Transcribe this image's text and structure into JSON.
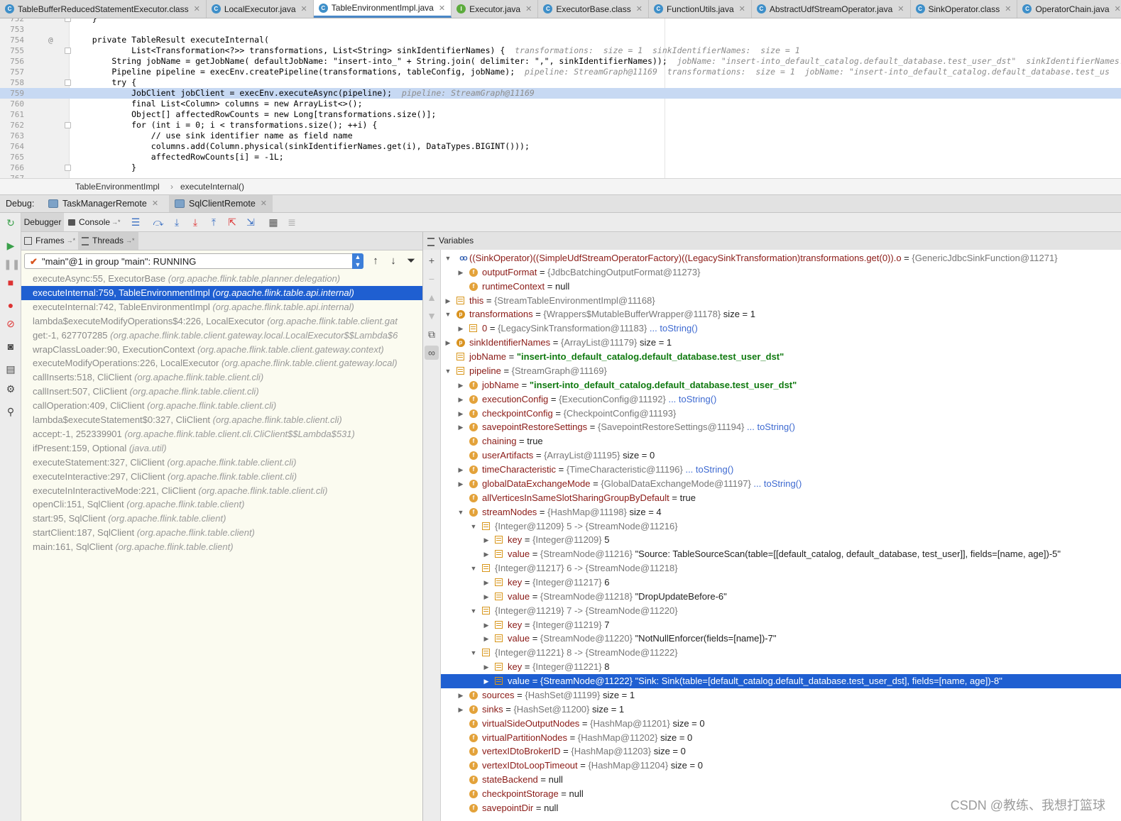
{
  "tabs": [
    {
      "label": "TableBufferReducedStatementExecutor.class",
      "icon": "C",
      "active": false
    },
    {
      "label": "LocalExecutor.java",
      "icon": "C",
      "active": false
    },
    {
      "label": "TableEnvironmentImpl.java",
      "icon": "C",
      "active": true
    },
    {
      "label": "Executor.java",
      "icon": "I",
      "active": false
    },
    {
      "label": "ExecutorBase.class",
      "icon": "C",
      "active": false
    },
    {
      "label": "FunctionUtils.java",
      "icon": "C",
      "active": false
    },
    {
      "label": "AbstractUdfStreamOperator.java",
      "icon": "C",
      "active": false
    },
    {
      "label": "SinkOperator.class",
      "icon": "C",
      "active": false
    },
    {
      "label": "OperatorChain.java",
      "icon": "C",
      "active": false
    },
    {
      "label": "S",
      "icon": "C",
      "active": false
    }
  ],
  "editor": {
    "lines": [
      {
        "num": "752",
        "code": "    }",
        "hint": "",
        "mark": ""
      },
      {
        "num": "753",
        "code": "",
        "hint": "",
        "mark": ""
      },
      {
        "num": "754",
        "code": "    private TableResult executeInternal(",
        "hint": "",
        "mark": "@"
      },
      {
        "num": "755",
        "code": "            List<Transformation<?>> transformations, List<String> sinkIdentifierNames) {",
        "hint": "  transformations:  size = 1  sinkIdentifierNames:  size = 1",
        "mark": ""
      },
      {
        "num": "756",
        "code": "        String jobName = getJobName( defaultJobName: \"insert-into_\" + String.join( delimiter: \",\", sinkIdentifierNames));",
        "hint": "  jobName: \"insert-into_default_catalog.default_database.test_user_dst\"  sinkIdentifierNames:",
        "mark": ""
      },
      {
        "num": "757",
        "code": "        Pipeline pipeline = execEnv.createPipeline(transformations, tableConfig, jobName);",
        "hint": "  pipeline: StreamGraph@11169  transformations:  size = 1  jobName: \"insert-into_default_catalog.default_database.test_us",
        "mark": ""
      },
      {
        "num": "758",
        "code": "        try {",
        "hint": "",
        "mark": ""
      },
      {
        "num": "759",
        "code": "            JobClient jobClient = execEnv.executeAsync(pipeline);",
        "hint": "  pipeline: StreamGraph@11169",
        "mark": ""
      },
      {
        "num": "760",
        "code": "            final List<Column> columns = new ArrayList<>();",
        "hint": "",
        "mark": ""
      },
      {
        "num": "761",
        "code": "            Object[] affectedRowCounts = new Long[transformations.size()];",
        "hint": "",
        "mark": ""
      },
      {
        "num": "762",
        "code": "            for (int i = 0; i < transformations.size(); ++i) {",
        "hint": "",
        "mark": ""
      },
      {
        "num": "763",
        "code": "                // use sink identifier name as field name",
        "hint": "",
        "mark": ""
      },
      {
        "num": "764",
        "code": "                columns.add(Column.physical(sinkIdentifierNames.get(i), DataTypes.BIGINT()));",
        "hint": "",
        "mark": ""
      },
      {
        "num": "765",
        "code": "                affectedRowCounts[i] = -1L;",
        "hint": "",
        "mark": ""
      },
      {
        "num": "766",
        "code": "            }",
        "hint": "",
        "mark": ""
      },
      {
        "num": "767",
        "code": "",
        "hint": "",
        "mark": ""
      }
    ]
  },
  "breadcrumb": {
    "class_name": "TableEnvironmentImpl",
    "separator": "›",
    "method": "executeInternal()"
  },
  "debug": {
    "label": "Debug:",
    "sessions": [
      {
        "label": "TaskManagerRemote",
        "active": false
      },
      {
        "label": "SqlClientRemote",
        "active": true
      }
    ],
    "tabs": {
      "debugger": "Debugger",
      "console": "Console",
      "console_suffix": "→*"
    }
  },
  "frames": {
    "tab_frames": "Frames",
    "tab_threads": "Threads",
    "tab_suffix": "→*",
    "thread": "\"main\"@1 in group \"main\": RUNNING",
    "items": [
      {
        "text": "executeAsync:55, ExecutorBase ",
        "pkg": "(org.apache.flink.table.planner.delegation)"
      },
      {
        "text": "executeInternal:759, TableEnvironmentImpl ",
        "pkg": "(org.apache.flink.table.api.internal)"
      },
      {
        "text": "executeInternal:742, TableEnvironmentImpl ",
        "pkg": "(org.apache.flink.table.api.internal)"
      },
      {
        "text": "lambda$executeModifyOperations$4:226, LocalExecutor ",
        "pkg": "(org.apache.flink.table.client.gat"
      },
      {
        "text": "get:-1, 627707285 ",
        "pkg": "(org.apache.flink.table.client.gateway.local.LocalExecutor$$Lambda$6"
      },
      {
        "text": "wrapClassLoader:90, ExecutionContext ",
        "pkg": "(org.apache.flink.table.client.gateway.context)"
      },
      {
        "text": "executeModifyOperations:226, LocalExecutor ",
        "pkg": "(org.apache.flink.table.client.gateway.local)"
      },
      {
        "text": "callInserts:518, CliClient ",
        "pkg": "(org.apache.flink.table.client.cli)"
      },
      {
        "text": "callInsert:507, CliClient ",
        "pkg": "(org.apache.flink.table.client.cli)"
      },
      {
        "text": "callOperation:409, CliClient ",
        "pkg": "(org.apache.flink.table.client.cli)"
      },
      {
        "text": "lambda$executeStatement$0:327, CliClient ",
        "pkg": "(org.apache.flink.table.client.cli)"
      },
      {
        "text": "accept:-1, 252339901 ",
        "pkg": "(org.apache.flink.table.client.cli.CliClient$$Lambda$531)"
      },
      {
        "text": "ifPresent:159, Optional ",
        "pkg": "(java.util)"
      },
      {
        "text": "executeStatement:327, CliClient ",
        "pkg": "(org.apache.flink.table.client.cli)"
      },
      {
        "text": "executeInteractive:297, CliClient ",
        "pkg": "(org.apache.flink.table.client.cli)"
      },
      {
        "text": "executeInInteractiveMode:221, CliClient ",
        "pkg": "(org.apache.flink.table.client.cli)"
      },
      {
        "text": "openCli:151, SqlClient ",
        "pkg": "(org.apache.flink.table.client)"
      },
      {
        "text": "start:95, SqlClient ",
        "pkg": "(org.apache.flink.table.client)"
      },
      {
        "text": "startClient:187, SqlClient ",
        "pkg": "(org.apache.flink.table.client)"
      },
      {
        "text": "main:161, SqlClient ",
        "pkg": "(org.apache.flink.table.client)"
      }
    ],
    "selected_index": 1
  },
  "variables": {
    "title": "Variables",
    "rows": [
      {
        "depth": 0,
        "tw": "▼",
        "icon": "oo",
        "name": "((SinkOperator)((SimpleUdfStreamOperatorFactory)((LegacySinkTransformation)transformations.get(0)).o",
        "eq": " = ",
        "value": "{GenericJdbcSinkFunction@11271}",
        "str": "",
        "extra": "",
        "link": ""
      },
      {
        "depth": 1,
        "tw": "▶",
        "icon": "f",
        "name": "outputFormat",
        "eq": " = ",
        "value": "{JdbcBatchingOutputFormat@11273}",
        "str": "",
        "extra": "",
        "link": ""
      },
      {
        "depth": 1,
        "tw": "",
        "icon": "f",
        "name": "runtimeContext",
        "eq": " = ",
        "value": "",
        "str": "",
        "extra": "null",
        "link": ""
      },
      {
        "depth": 0,
        "tw": "▶",
        "icon": "arr",
        "name": "this",
        "eq": " = ",
        "value": "{StreamTableEnvironmentImpl@11168}",
        "str": "",
        "extra": "",
        "link": ""
      },
      {
        "depth": 0,
        "tw": "▼",
        "icon": "p",
        "name": "transformations",
        "eq": " = ",
        "value": "{Wrappers$MutableBufferWrapper@11178}",
        "str": "",
        "extra": "  size = 1",
        "link": ""
      },
      {
        "depth": 1,
        "tw": "▶",
        "icon": "arr",
        "name": "0",
        "eq": " = ",
        "value": "{LegacySinkTransformation@11183}",
        "str": "",
        "extra": "",
        "link": " ... toString()"
      },
      {
        "depth": 0,
        "tw": "▶",
        "icon": "p",
        "name": "sinkIdentifierNames",
        "eq": " = ",
        "value": "{ArrayList@11179}",
        "str": "",
        "extra": "  size = 1",
        "link": ""
      },
      {
        "depth": 0,
        "tw": "",
        "icon": "arr",
        "name": "jobName",
        "eq": " = ",
        "value": "",
        "str": "\"insert-into_default_catalog.default_database.test_user_dst\"",
        "extra": "",
        "link": ""
      },
      {
        "depth": 0,
        "tw": "▼",
        "icon": "arr",
        "name": "pipeline",
        "eq": " = ",
        "value": "{StreamGraph@11169}",
        "str": "",
        "extra": "",
        "link": ""
      },
      {
        "depth": 1,
        "tw": "▶",
        "icon": "f",
        "name": "jobName",
        "eq": " = ",
        "value": "",
        "str": "\"insert-into_default_catalog.default_database.test_user_dst\"",
        "extra": "",
        "link": ""
      },
      {
        "depth": 1,
        "tw": "▶",
        "icon": "f",
        "name": "executionConfig",
        "eq": " = ",
        "value": "{ExecutionConfig@11192}",
        "str": "",
        "extra": "",
        "link": " ... toString()"
      },
      {
        "depth": 1,
        "tw": "▶",
        "icon": "f",
        "name": "checkpointConfig",
        "eq": " = ",
        "value": "{CheckpointConfig@11193}",
        "str": "",
        "extra": "",
        "link": ""
      },
      {
        "depth": 1,
        "tw": "▶",
        "icon": "f",
        "name": "savepointRestoreSettings",
        "eq": " = ",
        "value": "{SavepointRestoreSettings@11194}",
        "str": "",
        "extra": "",
        "link": " ... toString()"
      },
      {
        "depth": 1,
        "tw": "",
        "icon": "f",
        "name": "chaining",
        "eq": " = ",
        "value": "",
        "str": "",
        "extra": "true",
        "link": ""
      },
      {
        "depth": 1,
        "tw": "",
        "icon": "f",
        "name": "userArtifacts",
        "eq": " = ",
        "value": "{ArrayList@11195}",
        "str": "",
        "extra": "  size = 0",
        "link": ""
      },
      {
        "depth": 1,
        "tw": "▶",
        "icon": "f",
        "name": "timeCharacteristic",
        "eq": " = ",
        "value": "{TimeCharacteristic@11196}",
        "str": "",
        "extra": "",
        "link": " ... toString()"
      },
      {
        "depth": 1,
        "tw": "▶",
        "icon": "f",
        "name": "globalDataExchangeMode",
        "eq": " = ",
        "value": "{GlobalDataExchangeMode@11197}",
        "str": "",
        "extra": "",
        "link": " ... toString()"
      },
      {
        "depth": 1,
        "tw": "",
        "icon": "f",
        "name": "allVerticesInSameSlotSharingGroupByDefault",
        "eq": " = ",
        "value": "",
        "str": "",
        "extra": "true",
        "link": ""
      },
      {
        "depth": 1,
        "tw": "▼",
        "icon": "f",
        "name": "streamNodes",
        "eq": " = ",
        "value": "{HashMap@11198}",
        "str": "",
        "extra": "  size = 4",
        "link": ""
      },
      {
        "depth": 2,
        "tw": "▼",
        "icon": "arr",
        "name": "",
        "eq": "",
        "value": "{Integer@11209} 5 -> {StreamNode@11216}",
        "str": "",
        "extra": "",
        "link": ""
      },
      {
        "depth": 3,
        "tw": "▶",
        "icon": "arr",
        "name": "key",
        "eq": " = ",
        "value": "{Integer@11209} ",
        "str": "",
        "extra": "5",
        "link": ""
      },
      {
        "depth": 3,
        "tw": "▶",
        "icon": "arr",
        "name": "value",
        "eq": " = ",
        "value": "{StreamNode@11216} ",
        "str": "",
        "extra": "\"Source: TableSourceScan(table=[[default_catalog, default_database, test_user]], fields=[name, age])-5\"",
        "link": ""
      },
      {
        "depth": 2,
        "tw": "▼",
        "icon": "arr",
        "name": "",
        "eq": "",
        "value": "{Integer@11217} 6 -> {StreamNode@11218}",
        "str": "",
        "extra": "",
        "link": ""
      },
      {
        "depth": 3,
        "tw": "▶",
        "icon": "arr",
        "name": "key",
        "eq": " = ",
        "value": "{Integer@11217} ",
        "str": "",
        "extra": "6",
        "link": ""
      },
      {
        "depth": 3,
        "tw": "▶",
        "icon": "arr",
        "name": "value",
        "eq": " = ",
        "value": "{StreamNode@11218} ",
        "str": "",
        "extra": "\"DropUpdateBefore-6\"",
        "link": ""
      },
      {
        "depth": 2,
        "tw": "▼",
        "icon": "arr",
        "name": "",
        "eq": "",
        "value": "{Integer@11219} 7 -> {StreamNode@11220}",
        "str": "",
        "extra": "",
        "link": ""
      },
      {
        "depth": 3,
        "tw": "▶",
        "icon": "arr",
        "name": "key",
        "eq": " = ",
        "value": "{Integer@11219} ",
        "str": "",
        "extra": "7",
        "link": ""
      },
      {
        "depth": 3,
        "tw": "▶",
        "icon": "arr",
        "name": "value",
        "eq": " = ",
        "value": "{StreamNode@11220} ",
        "str": "",
        "extra": "\"NotNullEnforcer(fields=[name])-7\"",
        "link": ""
      },
      {
        "depth": 2,
        "tw": "▼",
        "icon": "arr",
        "name": "",
        "eq": "",
        "value": "{Integer@11221} 8 -> {StreamNode@11222}",
        "str": "",
        "extra": "",
        "link": ""
      },
      {
        "depth": 3,
        "tw": "▶",
        "icon": "arr",
        "name": "key",
        "eq": " = ",
        "value": "{Integer@11221} ",
        "str": "",
        "extra": "8",
        "link": ""
      },
      {
        "depth": 3,
        "tw": "▶",
        "icon": "arr",
        "name": "value",
        "eq": " = ",
        "value": "{StreamNode@11222} ",
        "str": "",
        "extra": "\"Sink: Sink(table=[default_catalog.default_database.test_user_dst], fields=[name, age])-8\"",
        "link": ""
      },
      {
        "depth": 1,
        "tw": "▶",
        "icon": "f",
        "name": "sources",
        "eq": " = ",
        "value": "{HashSet@11199}",
        "str": "",
        "extra": "  size = 1",
        "link": ""
      },
      {
        "depth": 1,
        "tw": "▶",
        "icon": "f",
        "name": "sinks",
        "eq": " = ",
        "value": "{HashSet@11200}",
        "str": "",
        "extra": "  size = 1",
        "link": ""
      },
      {
        "depth": 1,
        "tw": "",
        "icon": "f",
        "name": "virtualSideOutputNodes",
        "eq": " = ",
        "value": "{HashMap@11201}",
        "str": "",
        "extra": "  size = 0",
        "link": ""
      },
      {
        "depth": 1,
        "tw": "",
        "icon": "f",
        "name": "virtualPartitionNodes",
        "eq": " = ",
        "value": "{HashMap@11202}",
        "str": "",
        "extra": "  size = 0",
        "link": ""
      },
      {
        "depth": 1,
        "tw": "",
        "icon": "f",
        "name": "vertexIDtoBrokerID",
        "eq": " = ",
        "value": "{HashMap@11203}",
        "str": "",
        "extra": "  size = 0",
        "link": ""
      },
      {
        "depth": 1,
        "tw": "",
        "icon": "f",
        "name": "vertexIDtoLoopTimeout",
        "eq": " = ",
        "value": "{HashMap@11204}",
        "str": "",
        "extra": "  size = 0",
        "link": ""
      },
      {
        "depth": 1,
        "tw": "",
        "icon": "f",
        "name": "stateBackend",
        "eq": " = ",
        "value": "",
        "str": "",
        "extra": "null",
        "link": ""
      },
      {
        "depth": 1,
        "tw": "",
        "icon": "f",
        "name": "checkpointStorage",
        "eq": " = ",
        "value": "",
        "str": "",
        "extra": "null",
        "link": ""
      },
      {
        "depth": 1,
        "tw": "",
        "icon": "f",
        "name": "savepointDir",
        "eq": " = ",
        "value": "",
        "str": "",
        "extra": "null",
        "link": ""
      }
    ],
    "selected_index": 30
  },
  "watermark": "CSDN @教练、我想打篮球",
  "colors": {
    "selection": "#1f5fd1",
    "editor_highlight": "#c7d9f3",
    "frames_bg": "#fbfbf0",
    "tab_accent": "#4a88c7"
  }
}
